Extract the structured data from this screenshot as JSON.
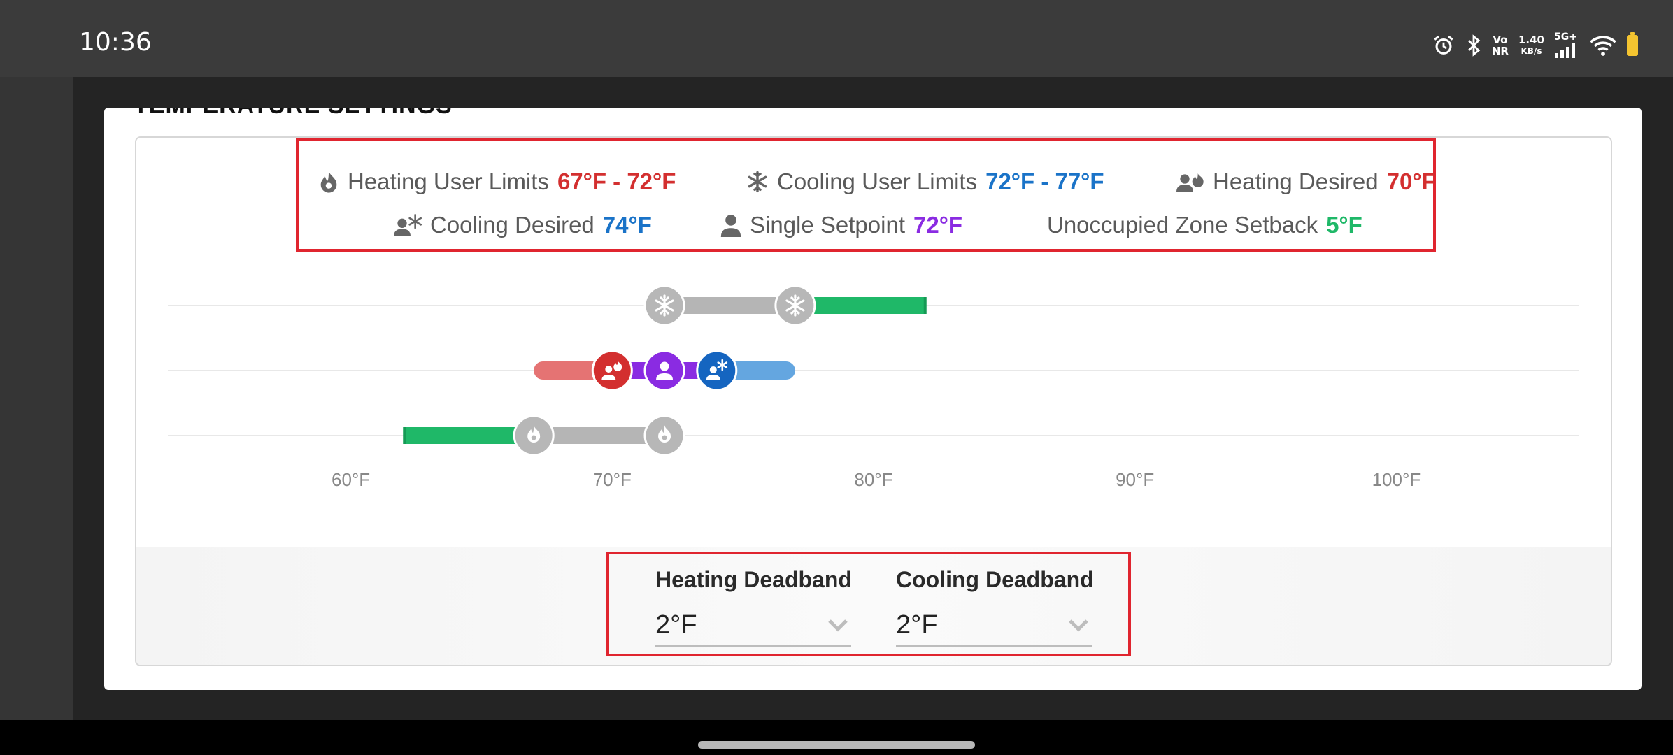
{
  "status": {
    "time": "10:36",
    "volte": "Vo",
    "volte_sub": "NR",
    "speed": "1.40",
    "speed_unit": "KB/s",
    "network": "5G+"
  },
  "section_title": "TEMPERATURE SETTINGS",
  "legend": {
    "heating_limits": {
      "label": "Heating User Limits",
      "value": "67°F - 72°F",
      "color": "#d32f2f"
    },
    "cooling_limits": {
      "label": "Cooling User Limits",
      "value": "72°F - 77°F",
      "color": "#1a73c8"
    },
    "heating_desired": {
      "label": "Heating Desired",
      "value": "70°F",
      "color": "#d32f2f"
    },
    "cooling_desired": {
      "label": "Cooling Desired",
      "value": "74°F",
      "color": "#1a73c8"
    },
    "single_setpoint": {
      "label": "Single Setpoint",
      "value": "72°F",
      "color": "#8a2be2"
    },
    "zone_setback": {
      "label": "Unoccupied Zone Setback",
      "value": "5°F",
      "color": "#1fb868"
    }
  },
  "chart_data": {
    "type": "range",
    "x_ticks": [
      "60°F",
      "70°F",
      "80°F",
      "90°F",
      "100°F"
    ],
    "xlim": [
      53,
      107
    ],
    "rows": [
      {
        "name": "cooling",
        "limits": [
          72,
          77
        ],
        "setback": [
          77,
          82
        ]
      },
      {
        "name": "desired",
        "heating_range": [
          67,
          70
        ],
        "single": 72,
        "cooling_range": [
          74,
          77
        ],
        "markers": {
          "heating_desired": 70,
          "single_setpoint": 72,
          "cooling_desired": 74
        }
      },
      {
        "name": "heating",
        "limits": [
          67,
          72
        ],
        "setback": [
          62,
          67
        ]
      }
    ],
    "colors": {
      "limit_bar": "#b5b5b5",
      "setback": "#1fb868",
      "heating": "#e57373",
      "heating_dark": "#d32f2f",
      "cooling": "#64a6e0",
      "cooling_dark": "#1565c0",
      "single": "#8a2be2",
      "grid": "#e8e8e8",
      "knob": "#b7b7b7"
    }
  },
  "deadband": {
    "heating": {
      "label": "Heating Deadband",
      "value": "2°F"
    },
    "cooling": {
      "label": "Cooling Deadband",
      "value": "2°F"
    }
  }
}
